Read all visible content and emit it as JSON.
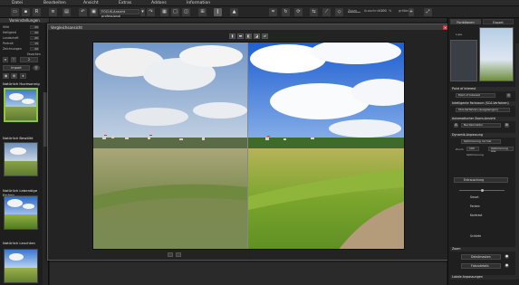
{
  "menubar": {
    "items": [
      "Datei",
      "Bearbeiten",
      "Ansicht",
      "Extras",
      "Addons",
      "Information"
    ]
  },
  "toolbar": {
    "preset_dropdown": "FOCUS-Ansicht professional",
    "helligkeit_label": "Zoom",
    "ausschnitt_label": "Ausschnitt",
    "zoom_value": "100",
    "percent": "%",
    "groesse_label": "größer"
  },
  "left_panel": {
    "header": "Voreinstellungen",
    "rows": [
      {
        "label": "Hilfe",
        "value": "20"
      },
      {
        "label": "Helligkeit",
        "value": "20"
      },
      {
        "label": "Landschaft",
        "value": "20"
      },
      {
        "label": "Portrait",
        "value": "15"
      },
      {
        "label": "Zeichnungen",
        "value": "20"
      }
    ],
    "favoriten_label": "Favoriten",
    "filter_value": "2",
    "import_label": "Import",
    "presets": [
      {
        "label": "Natürlich Hochsonnig"
      },
      {
        "label": "Natürlich Bewölkt"
      },
      {
        "label": "Natürlich Lebendige Farben"
      },
      {
        "label": "Natürlich Leuchten"
      }
    ]
  },
  "dialog": {
    "title": "Vergleichsansicht",
    "close": "✕"
  },
  "right_panel": {
    "tabs": [
      "Funktionen",
      "Export"
    ],
    "header_top": "Lupe",
    "sections": [
      {
        "label": "Point of Interest",
        "field": "Point of Interest"
      },
      {
        "label": "Intelligente Farbraum (SCA-Verfahren)",
        "field": "SCA-Verfahren (ausgewogen)"
      },
      {
        "label": "Automatischer Zoom-Ansicht",
        "field": "Nachkorrektur"
      },
      {
        "label": "Dynamik-Anpassung",
        "field": "Optimierung normal"
      }
    ],
    "zoom_label": "Zoom",
    "zoom_value": "100",
    "optimierung_label": "Optimierung",
    "optimierung_value": "Optimierung aus",
    "tools": [
      {
        "label": "Entrauschung"
      },
      {
        "label": "Smart"
      },
      {
        "label": "Farben"
      },
      {
        "label": "Kontrast"
      },
      {
        "label": "Schärfe"
      }
    ],
    "bottom_header": "Zoom",
    "bottom_tools": [
      {
        "label": "Detailmasken"
      },
      {
        "label": "Fokusdetails"
      }
    ],
    "footer": "Lokale Anpassungen"
  }
}
